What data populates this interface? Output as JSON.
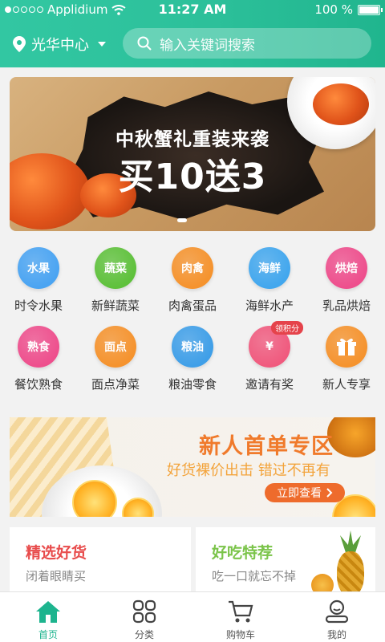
{
  "status_bar": {
    "carrier": "Applidium",
    "time": "11:27 AM",
    "battery": "100 %"
  },
  "header": {
    "location": "光华中心",
    "search_placeholder": "输入关键词搜索"
  },
  "banner": {
    "title": "中秋蟹礼重装来袭",
    "headline": "买10送3"
  },
  "categories": [
    {
      "icon_text": "水果",
      "label": "时令水果",
      "color": "#4aa4f2",
      "icon": "apple-icon"
    },
    {
      "icon_text": "蔬菜",
      "label": "新鲜蔬菜",
      "color": "#5fc13c",
      "icon": "vegetable-icon"
    },
    {
      "icon_text": "肉禽",
      "label": "肉禽蛋品",
      "color": "#f5932e",
      "icon": "meat-icon"
    },
    {
      "icon_text": "海鲜",
      "label": "海鲜水产",
      "color": "#42a7ee",
      "icon": "shrimp-icon"
    },
    {
      "icon_text": "烘焙",
      "label": "乳品烘焙",
      "color": "#ee4f8d",
      "icon": "cake-icon"
    },
    {
      "icon_text": "熟食",
      "label": "餐饮熟食",
      "color": "#ee4f8d",
      "icon": "chicken-icon"
    },
    {
      "icon_text": "面点",
      "label": "面点净菜",
      "color": "#f5932e",
      "icon": "bowl-icon"
    },
    {
      "icon_text": "粮油",
      "label": "粮油零食",
      "color": "#3f9fe8",
      "icon": "oil-icon"
    },
    {
      "icon_text": "¥",
      "label": "邀请有奖",
      "color": "#f05a7e",
      "icon": "red-envelope-icon",
      "badge": "领积分"
    },
    {
      "icon_text": "",
      "label": "新人专享",
      "color": "#f5932e",
      "icon": "gift-icon"
    }
  ],
  "promo": {
    "title": "新人首单专区",
    "subtitle": "好货裸价出击 错过不再有",
    "button": "立即查看"
  },
  "cards": [
    {
      "title": "精选好货",
      "subtitle": "闭着眼睛买",
      "color": "#e84c4c"
    },
    {
      "title": "好吃特荐",
      "subtitle": "吃一口就忘不掉",
      "color": "#7bc44a"
    }
  ],
  "tabs": [
    {
      "label": "首页",
      "active": true
    },
    {
      "label": "分类",
      "active": false
    },
    {
      "label": "购物车",
      "active": false
    },
    {
      "label": "我的",
      "active": false
    }
  ]
}
